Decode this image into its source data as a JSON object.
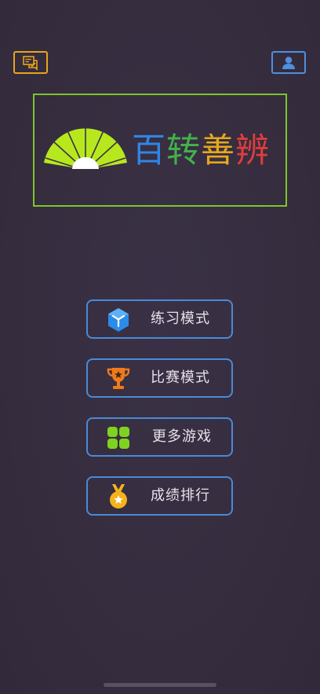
{
  "app": {
    "title_chars": [
      {
        "char": "百",
        "color": "#2f86e8"
      },
      {
        "char": "转",
        "color": "#43b04a"
      },
      {
        "char": "善",
        "color": "#e6a81c"
      },
      {
        "char": "辨",
        "color": "#e13d3d"
      }
    ]
  },
  "header": {
    "feedback_icon": "feedback-chat-icon",
    "profile_icon": "user-icon",
    "feedback_color": "#e6a51c",
    "profile_color": "#4d8fe0"
  },
  "logo": {
    "icon": "folding-fan-icon",
    "border_color": "#7ec629",
    "fan_color": "#b7e81e"
  },
  "menu": [
    {
      "label": "练习模式",
      "icon": "cube-icon",
      "color": "#2a8ce8"
    },
    {
      "label": "比赛模式",
      "icon": "trophy-icon",
      "color": "#f07a1a"
    },
    {
      "label": "更多游戏",
      "icon": "grid-icon",
      "color": "#7ed321"
    },
    {
      "label": "成绩排行",
      "icon": "medal-icon",
      "color": "#f5b21b"
    }
  ]
}
